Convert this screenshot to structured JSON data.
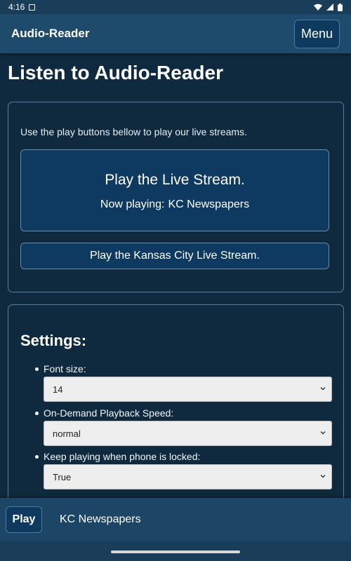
{
  "status_bar": {
    "time": "4:16"
  },
  "app_bar": {
    "title": "Audio-Reader",
    "menu_label": "Menu"
  },
  "page_title": "Listen to Audio-Reader",
  "streams": {
    "intro": "Use the play buttons bellow to play our live streams.",
    "live_button": {
      "label": "Play the Live Stream.",
      "now_playing_prefix": "Now playing:",
      "now_playing_value": "KC Newspapers"
    },
    "kc_button": {
      "label": "Play the Kansas City Live Stream."
    }
  },
  "settings": {
    "title": "Settings:",
    "items": [
      {
        "label": "Font size:",
        "value": "14"
      },
      {
        "label": "On-Demand Playback Speed:",
        "value": "normal"
      },
      {
        "label": "Keep playing when phone is locked:",
        "value": "True"
      }
    ]
  },
  "bottom_bar": {
    "play_label": "Play",
    "now_playing": "KC Newspapers"
  },
  "colors": {
    "background": "#0f2a3e",
    "app_bar": "#1e4a6c",
    "button": "#0e3a62",
    "select_bg": "#eeeeee"
  },
  "icons": [
    "wifi-icon",
    "signal-icon",
    "battery-icon",
    "chevron-down-icon"
  ]
}
